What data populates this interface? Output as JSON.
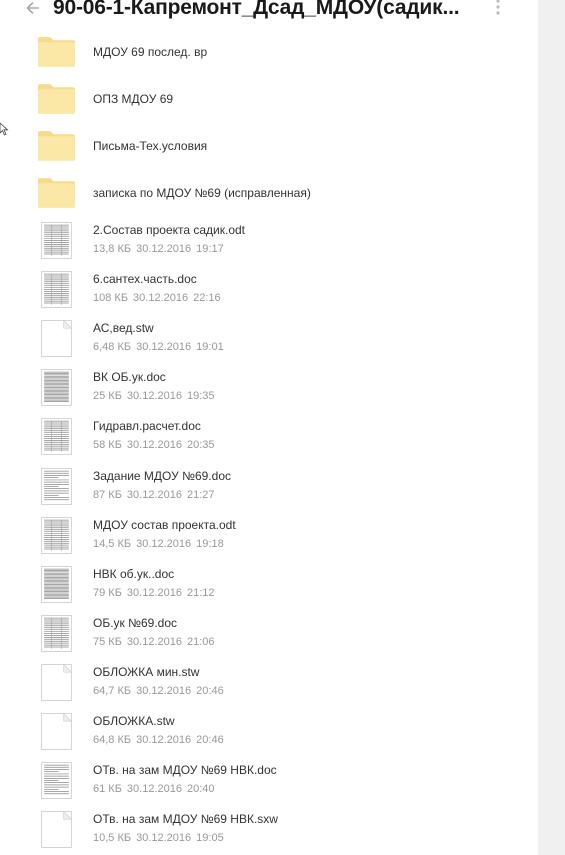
{
  "header": {
    "title": "90-06-1-Капремонт_Дсад_МДОУ(садик..."
  },
  "folders": [
    {
      "name": "МДОУ 69 послед. вр"
    },
    {
      "name": "ОПЗ МДОУ 69"
    },
    {
      "name": "Письма-Тех.условия"
    },
    {
      "name": "записка по МДОУ №69 (исправленная)"
    }
  ],
  "files": [
    {
      "name": "2.Состав проекта садик.odt",
      "size": "13,8 КБ",
      "date": "30.12.2016",
      "time": "19:17",
      "thumb": "doc-table"
    },
    {
      "name": "6.сантех.часть.doc",
      "size": "108 КБ",
      "date": "30.12.2016",
      "time": "22:16",
      "thumb": "doc-form"
    },
    {
      "name": "АС,вед.stw",
      "size": "6,48 КБ",
      "date": "30.12.2016",
      "time": "19:01",
      "thumb": "blank-page"
    },
    {
      "name": "ВК ОБ.ук.doc",
      "size": "25 КБ",
      "date": "30.12.2016",
      "time": "19:35",
      "thumb": "doc-dense"
    },
    {
      "name": "Гидравл.расчет.doc",
      "size": "58 КБ",
      "date": "30.12.2016",
      "time": "20:35",
      "thumb": "doc-table"
    },
    {
      "name": "Задание МДОУ №69.doc",
      "size": "87 КБ",
      "date": "30.12.2016",
      "time": "21:27",
      "thumb": "doc-text"
    },
    {
      "name": "МДОУ состав проекта.odt",
      "size": "14,5 КБ",
      "date": "30.12.2016",
      "time": "19:18",
      "thumb": "doc-table"
    },
    {
      "name": "НВК об.ук..doc",
      "size": "79 КБ",
      "date": "30.12.2016",
      "time": "21:12",
      "thumb": "doc-dense"
    },
    {
      "name": "ОБ.ук №69.doc",
      "size": "75 КБ",
      "date": "30.12.2016",
      "time": "21:06",
      "thumb": "doc-table"
    },
    {
      "name": "ОБЛОЖКА мин.stw",
      "size": "64,7 КБ",
      "date": "30.12.2016",
      "time": "20:46",
      "thumb": "blank-page"
    },
    {
      "name": "ОБЛОЖКА.stw",
      "size": "64,8 КБ",
      "date": "30.12.2016",
      "time": "20:46",
      "thumb": "blank-page"
    },
    {
      "name": "ОТв. на зам МДОУ №69 НВК.doc",
      "size": "61 КБ",
      "date": "30.12.2016",
      "time": "20:40",
      "thumb": "doc-text"
    },
    {
      "name": "ОТв. на зам МДОУ №69 НВК.sxw",
      "size": "10,5 КБ",
      "date": "30.12.2016",
      "time": "19:05",
      "thumb": "blank-page"
    }
  ],
  "colors": {
    "folder": "#fbe8a6",
    "folder_tab": "#f6dc8a",
    "accent_text": "#333333",
    "meta_text": "#999999"
  }
}
